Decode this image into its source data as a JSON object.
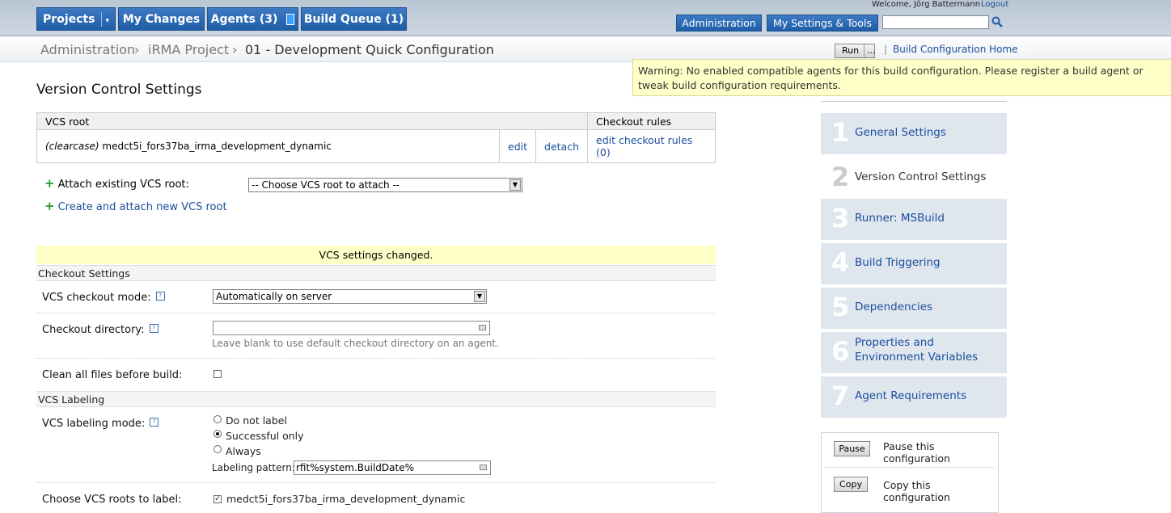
{
  "nav": {
    "projects": "Projects",
    "my_changes": "My Changes",
    "agents": "Agents (3)",
    "build_queue": "Build Queue (1)"
  },
  "header": {
    "welcome": "Welcome, Jörg Battermann",
    "logout": "Logout",
    "administration": "Administration",
    "my_settings": "My Settings & Tools",
    "search_value": ""
  },
  "breadcrumb": {
    "items": [
      "Administration",
      "iRMA Project",
      "01 - Development Quick Configuration"
    ],
    "run": "Run",
    "run_more": "...",
    "build_config_home": "Build Configuration Home"
  },
  "warning": "Warning: No enabled compatible agents for this build configuration. Please register a build agent or tweak build configuration requirements.",
  "page_title": "Version Control Settings",
  "vcs_table": {
    "col_root": "VCS root",
    "col_rules": "Checkout rules",
    "row": {
      "type": "(clearcase)",
      "name": "medct5i_fors37ba_irma_development_dynamic",
      "edit": "edit",
      "detach": "detach",
      "edit_rules": "edit checkout rules (0)"
    }
  },
  "attach": {
    "label": "Attach existing VCS root:",
    "select_value": "-- Choose VCS root to attach --",
    "create": "Create and attach new VCS root"
  },
  "changed_notice": "VCS settings changed.",
  "checkout": {
    "section": "Checkout Settings",
    "mode_label": "VCS checkout mode:",
    "mode_value": "Automatically on server",
    "dir_label": "Checkout directory:",
    "dir_value": "",
    "dir_note": "Leave blank to use default checkout directory on an agent.",
    "clean_label": "Clean all files before build:"
  },
  "labeling": {
    "section": "VCS Labeling",
    "mode_label": "VCS labeling mode:",
    "options": [
      "Do not label",
      "Successful only",
      "Always"
    ],
    "selected": "Successful only",
    "pattern_label": "Labeling pattern:",
    "pattern_value": "rfit%system.BuildDate%",
    "roots_label": "Choose VCS roots to label:",
    "root_name": "medct5i_fors37ba_irma_development_dynamic"
  },
  "steps": [
    {
      "num": "1",
      "label": "General Settings"
    },
    {
      "num": "2",
      "label": "Version Control Settings"
    },
    {
      "num": "3",
      "label": "Runner: MSBuild"
    },
    {
      "num": "4",
      "label": "Build Triggering"
    },
    {
      "num": "5",
      "label": "Dependencies"
    },
    {
      "num": "6",
      "label": "Properties and Environment Variables"
    },
    {
      "num": "7",
      "label": "Agent Requirements"
    }
  ],
  "actions": {
    "pause_btn": "Pause",
    "pause_text": "Pause this configuration",
    "copy_btn": "Copy",
    "copy_text": "Copy this configuration"
  },
  "colors": {
    "nav_blue": "#1f5ea8",
    "warning_bg": "#ffffc8",
    "step_bg": "#dfe6ee",
    "link": "#1a4f9c"
  }
}
